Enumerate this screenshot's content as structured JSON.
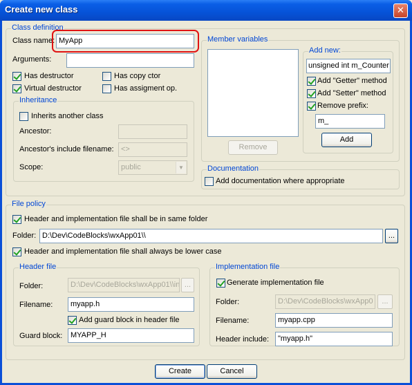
{
  "window": {
    "title": "Create new class",
    "close": "✕"
  },
  "class_definition": {
    "legend": "Class definition",
    "class_name_label": "Class name:",
    "class_name_value": "MyApp",
    "arguments_label": "Arguments:",
    "arguments_value": "",
    "has_destructor": "Has destructor",
    "has_copy_ctor": "Has copy ctor",
    "virtual_destructor": "Virtual destructor",
    "has_assignment_op": "Has assigment op."
  },
  "inheritance": {
    "legend": "Inheritance",
    "inherits_label": "Inherits another class",
    "ancestor_label": "Ancestor:",
    "ancestor_value": "",
    "ancestor_include_label": "Ancestor's include filename:",
    "ancestor_include_value": "<>",
    "scope_label": "Scope:",
    "scope_value": "public"
  },
  "member_variables": {
    "legend": "Member variables",
    "remove_button": "Remove",
    "add_new_legend": "Add new:",
    "new_member_value": "unsigned int m_Counter",
    "add_getter": "Add \"Getter\" method",
    "add_setter": "Add \"Setter\" method",
    "remove_prefix": "Remove prefix:",
    "prefix_value": "m_",
    "add_button": "Add"
  },
  "documentation": {
    "legend": "Documentation",
    "add_doc": "Add documentation where appropriate"
  },
  "file_policy": {
    "legend": "File policy",
    "same_folder": "Header and implementation file shall be in same folder",
    "folder_label": "Folder:",
    "folder_value": "D:\\Dev\\CodeBlocks\\wxApp01\\\\",
    "browse": "...",
    "lower_case": "Header and implementation file shall always be lower case"
  },
  "header_file": {
    "legend": "Header file",
    "folder_label": "Folder:",
    "folder_value": "D:\\Dev\\CodeBlocks\\wxApp01\\\\in",
    "browse": "...",
    "filename_label": "Filename:",
    "filename_value": "myapp.h",
    "guard_check": "Add guard block in header file",
    "guard_label": "Guard block:",
    "guard_value": "MYAPP_H"
  },
  "implementation_file": {
    "legend": "Implementation file",
    "generate": "Generate implementation file",
    "folder_label": "Folder:",
    "folder_value": "D:\\Dev\\CodeBlocks\\wxApp0",
    "browse": "...",
    "filename_label": "Filename:",
    "filename_value": "myapp.cpp",
    "header_include_label": "Header include:",
    "header_include_value": "\"myapp.h\""
  },
  "buttons": {
    "create": "Create",
    "cancel": "Cancel"
  }
}
